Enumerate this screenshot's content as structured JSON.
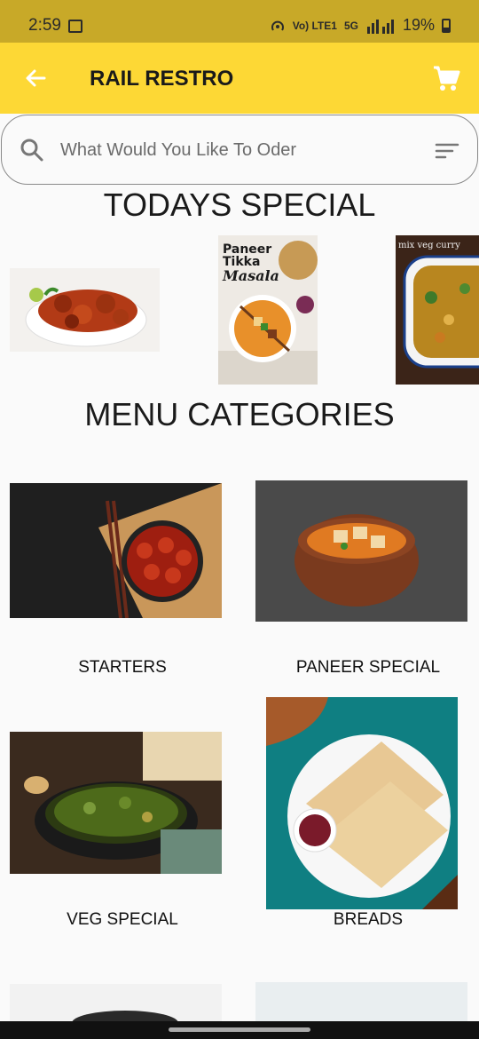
{
  "status_bar": {
    "time": "2:59",
    "network": "Vo) LTE1",
    "network_gen": "5G",
    "battery": "19%"
  },
  "app_bar": {
    "title": "RAIL RESTRO"
  },
  "search": {
    "placeholder": "What Would You Like To Oder"
  },
  "todays_special": {
    "title": "TODAYS SPECIAL",
    "items": [
      {
        "image": "chilli-chicken-photo"
      },
      {
        "image": "paneer-tikka-masala-photo",
        "caption_top": "Paneer",
        "caption_mid": "Tikka",
        "caption_script": "Masala"
      },
      {
        "image": "mix-veg-curry-photo",
        "caption": "mix veg curry"
      }
    ]
  },
  "menu_categories": {
    "title": "MENU CATEGORIES",
    "items": [
      {
        "label": "STARTERS",
        "image": "starters-photo"
      },
      {
        "label": "PANEER SPECIAL",
        "image": "paneer-special-photo"
      },
      {
        "label": "VEG SPECIAL",
        "image": "veg-special-photo"
      },
      {
        "label": "BREADS",
        "image": "breads-photo"
      }
    ]
  },
  "colors": {
    "app_bar": "#fdd835",
    "status_bar": "#c8a928",
    "background": "#fafafa"
  }
}
